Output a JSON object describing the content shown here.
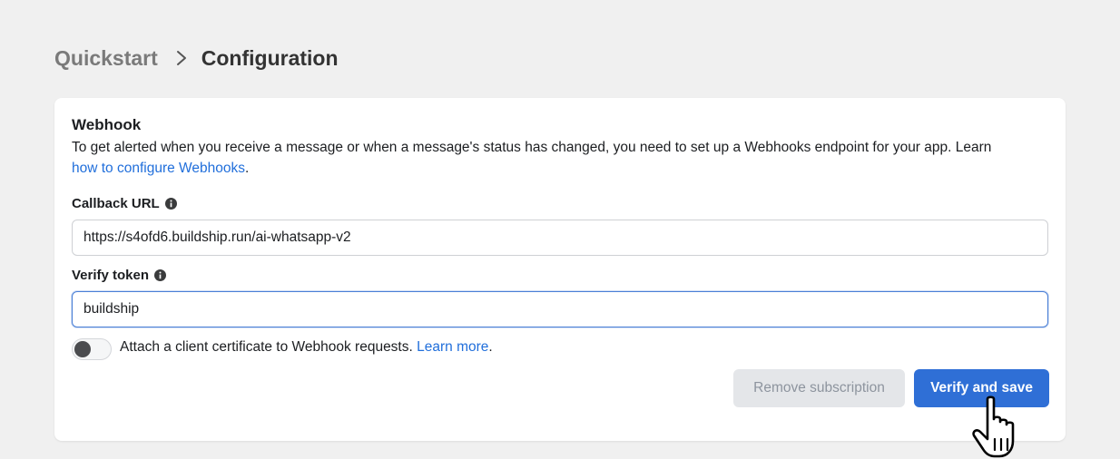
{
  "breadcrumb": {
    "parent": "Quickstart",
    "current": "Configuration",
    "separator_icon": "chevron-right-icon"
  },
  "webhook": {
    "title": "Webhook",
    "description": "To get alerted when you receive a message or when a message's status has changed, you need to set up a Webhooks endpoint for your app. Learn",
    "description_link": "how to configure Webhooks",
    "description_end": ".",
    "callback_label": "Callback URL",
    "callback_value": "https://s4ofd6.buildship.run/ai-whatsapp-v2",
    "verify_label": "Verify token",
    "verify_value": "buildship",
    "info_icon": "info-icon",
    "toggle_text": "Attach a client certificate to Webhook requests.",
    "toggle_link": "Learn more",
    "toggle_end": ".",
    "toggle_state": "off",
    "remove_button": "Remove subscription",
    "verify_button": "Verify and save"
  },
  "colors": {
    "accent": "#2f6fd6",
    "link": "#216fdb",
    "background": "#f0f0f0",
    "disabled_button": "#e4e6e9"
  },
  "cursor": "hand-pointer-icon"
}
